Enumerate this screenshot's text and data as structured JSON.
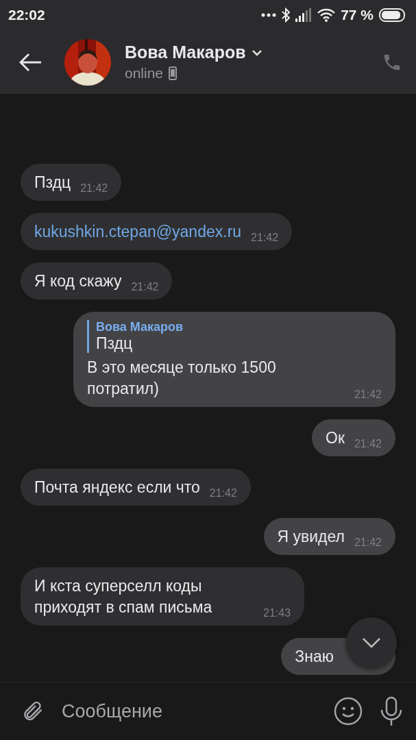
{
  "status_bar": {
    "time": "22:02",
    "battery": "77 %"
  },
  "header": {
    "name": "Вова Макаров",
    "status": "online"
  },
  "messages": [
    {
      "outgoing": false,
      "kind": "text",
      "text": "Пздц",
      "time": "21:42"
    },
    {
      "outgoing": false,
      "kind": "link",
      "text": "kukushkin.ctepan@yandex.ru",
      "time": "21:42"
    },
    {
      "outgoing": false,
      "kind": "text",
      "text": "Я код скажу",
      "time": "21:42"
    },
    {
      "outgoing": true,
      "kind": "reply",
      "reply": {
        "author": "Вова Макаров",
        "text": "Пздц"
      },
      "text": "В это месяце только 1500 потратил)",
      "time": "21:42"
    },
    {
      "outgoing": true,
      "kind": "text",
      "text": "Ок",
      "time": "21:42"
    },
    {
      "outgoing": false,
      "kind": "text",
      "text": "Почта яндекс если что",
      "time": "21:42"
    },
    {
      "outgoing": true,
      "kind": "text",
      "text": "Я увидел",
      "time": "21:42"
    },
    {
      "outgoing": false,
      "kind": "text",
      "text": "И кста суперселл коды приходят в спам письма",
      "time": "21:43"
    },
    {
      "outgoing": true,
      "kind": "text",
      "text": "Знаю"
    }
  ],
  "composer": {
    "placeholder": "Сообщение"
  }
}
